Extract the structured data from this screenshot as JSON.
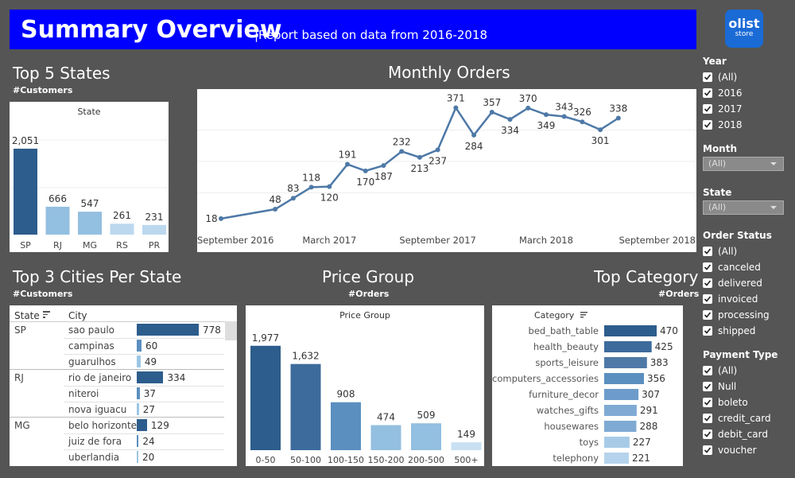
{
  "header": {
    "title": "Summary Overview",
    "subtitle": "|Report based on data from 2016-2018",
    "logo_line1": "olist",
    "logo_line2": "store"
  },
  "top_states": {
    "title": "Top 5 States",
    "subtitle": "#Customers",
    "caption": "State",
    "chart_data": {
      "type": "bar",
      "categories": [
        "SP",
        "RJ",
        "MG",
        "RS",
        "PR"
      ],
      "values": [
        2051,
        666,
        547,
        261,
        231
      ],
      "labels": [
        "2,051",
        "666",
        "547",
        "261",
        "231"
      ],
      "colors": [
        "#2d5d8c",
        "#93bfe0",
        "#93bfe0",
        "#bcd8ee",
        "#bcd8ee"
      ],
      "ylim": [
        0,
        2600
      ]
    }
  },
  "monthly_orders": {
    "title": "Monthly Orders",
    "chart_data": {
      "type": "line",
      "x": [
        "2016-09",
        "2016-10",
        "2016-11",
        "2016-12",
        "2017-01",
        "2017-02",
        "2017-03",
        "2017-04",
        "2017-05",
        "2017-06",
        "2017-07",
        "2017-08",
        "2017-09",
        "2017-10",
        "2017-11",
        "2017-12",
        "2018-01",
        "2018-02",
        "2018-03",
        "2018-04",
        "2018-05",
        "2018-06",
        "2018-07",
        "2018-08",
        "2018-09",
        "2018-10"
      ],
      "values": [
        18,
        48,
        83,
        118,
        120,
        191,
        170,
        187,
        232,
        213,
        237,
        371,
        284,
        357,
        334,
        370,
        349,
        343,
        326,
        301,
        338
      ],
      "points": [
        {
          "x": "2016-09",
          "y": 18
        },
        {
          "x": "2016-12",
          "y": 48
        },
        {
          "x": "2017-01",
          "y": 83
        },
        {
          "x": "2017-02",
          "y": 118
        },
        {
          "x": "2017-03",
          "y": 120
        },
        {
          "x": "2017-04",
          "y": 191
        },
        {
          "x": "2017-05",
          "y": 170
        },
        {
          "x": "2017-06",
          "y": 187
        },
        {
          "x": "2017-07",
          "y": 232
        },
        {
          "x": "2017-08",
          "y": 213
        },
        {
          "x": "2017-09",
          "y": 237
        },
        {
          "x": "2017-10",
          "y": 371
        },
        {
          "x": "2017-11",
          "y": 284
        },
        {
          "x": "2017-12",
          "y": 357
        },
        {
          "x": "2018-01",
          "y": 334
        },
        {
          "x": "2018-02",
          "y": 370
        },
        {
          "x": "2018-03",
          "y": 349
        },
        {
          "x": "2018-04",
          "y": 343
        },
        {
          "x": "2018-05",
          "y": 326
        },
        {
          "x": "2018-06",
          "y": 301
        },
        {
          "x": "2018-07",
          "y": 338
        }
      ],
      "xticks": [
        "September 2016",
        "March 2017",
        "September 2017",
        "March 2018",
        "September 2018"
      ],
      "ylim": [
        0,
        400
      ],
      "color": "#4e79a7",
      "grid": true
    }
  },
  "top_cities": {
    "title": "Top 3 Cities Per State",
    "subtitle": "#Customers",
    "col_state": "State",
    "col_city": "City",
    "bar_max": 778,
    "groups": [
      {
        "state": "SP",
        "rows": [
          {
            "city": "sao paulo",
            "value": 778,
            "color": "#2d5d8c"
          },
          {
            "city": "campinas",
            "value": 60,
            "color": "#5b8fbf"
          },
          {
            "city": "guarulhos",
            "value": 49,
            "color": "#9dc6e4"
          }
        ]
      },
      {
        "state": "RJ",
        "rows": [
          {
            "city": "rio de janeiro",
            "value": 334,
            "color": "#2d5d8c"
          },
          {
            "city": "niteroi",
            "value": 37,
            "color": "#5b8fbf"
          },
          {
            "city": "nova iguacu",
            "value": 27,
            "color": "#9dc6e4"
          }
        ]
      },
      {
        "state": "MG",
        "rows": [
          {
            "city": "belo horizonte",
            "value": 129,
            "color": "#2d5d8c"
          },
          {
            "city": "juiz de fora",
            "value": 24,
            "color": "#5b8fbf"
          },
          {
            "city": "uberlandia",
            "value": 20,
            "color": "#9dc6e4"
          }
        ]
      }
    ]
  },
  "price_group": {
    "title": "Price Group",
    "subtitle": "#Orders",
    "caption": "Price Group",
    "chart_data": {
      "type": "bar",
      "categories": [
        "0-50",
        "50-100",
        "100-150",
        "150-200",
        "200-500",
        "500+"
      ],
      "values": [
        1977,
        1632,
        908,
        474,
        509,
        149
      ],
      "labels": [
        "1,977",
        "1,632",
        "908",
        "474",
        "509",
        "149"
      ],
      "colors": [
        "#2d5d8c",
        "#3d6b9c",
        "#5b8fbf",
        "#93bfe0",
        "#93bfe0",
        "#c8e0f2"
      ],
      "ylim": [
        0,
        2350
      ]
    }
  },
  "top_category": {
    "title": "Top Category",
    "subtitle": "#Orders",
    "caption": "Category",
    "chart_data": {
      "type": "bar",
      "categories": [
        "bed_bath_table",
        "health_beauty",
        "sports_leisure",
        "computers_accessories",
        "furniture_decor",
        "watches_gifts",
        "housewares",
        "toys",
        "telephony"
      ],
      "values": [
        470,
        425,
        383,
        356,
        307,
        291,
        288,
        227,
        221
      ],
      "colors": [
        "#2d5d8c",
        "#3d6b9c",
        "#4e79a7",
        "#5b8fbf",
        "#6d9ccb",
        "#7faad3",
        "#7faad3",
        "#a7cbe7",
        "#b5d3ec"
      ],
      "xlim": [
        0,
        470
      ]
    }
  },
  "filters": {
    "year": {
      "title": "Year",
      "options": [
        "(All)",
        "2016",
        "2017",
        "2018"
      ]
    },
    "month": {
      "title": "Month",
      "value": "(All)"
    },
    "state": {
      "title": "State",
      "value": "(All)"
    },
    "order_status": {
      "title": "Order Status",
      "options": [
        "(All)",
        "canceled",
        "delivered",
        "invoiced",
        "processing",
        "shipped"
      ]
    },
    "payment_type": {
      "title": "Payment Type",
      "options": [
        "(All)",
        "Null",
        "boleto",
        "credit_card",
        "debit_card",
        "voucher"
      ]
    }
  }
}
